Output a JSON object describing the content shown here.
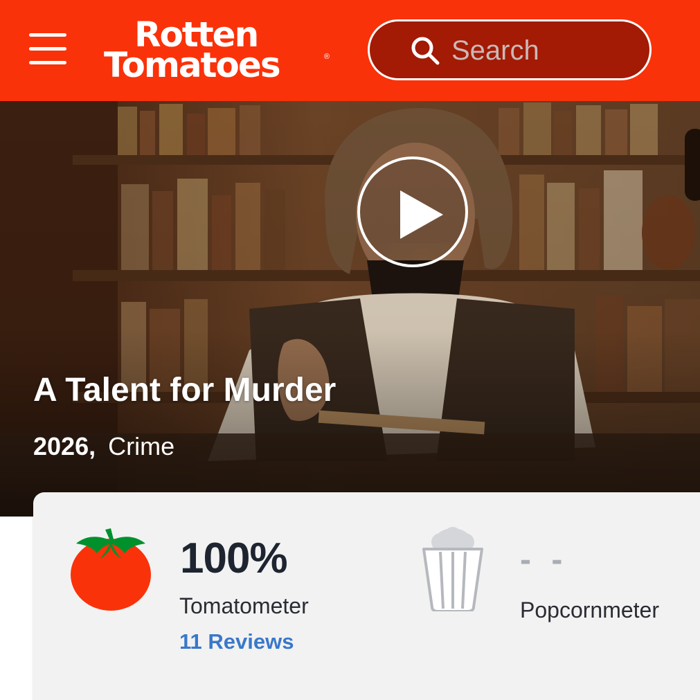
{
  "header": {
    "logo_line1": "Rotten",
    "logo_line2": "Tomatoes",
    "logo_reg": "®",
    "search_placeholder": "Search",
    "brand_color": "#fa320a"
  },
  "hero": {
    "title": "A Talent for Murder",
    "year": "2026,",
    "genre": "Crime",
    "play_icon": "play-icon"
  },
  "scores": {
    "tomatometer": {
      "value": "100%",
      "label": "Tomatometer",
      "reviews": "11 Reviews",
      "icon": "tomato-icon"
    },
    "popcornmeter": {
      "value": "- -",
      "label": "Popcornmeter",
      "icon": "popcorn-bucket-icon"
    }
  }
}
